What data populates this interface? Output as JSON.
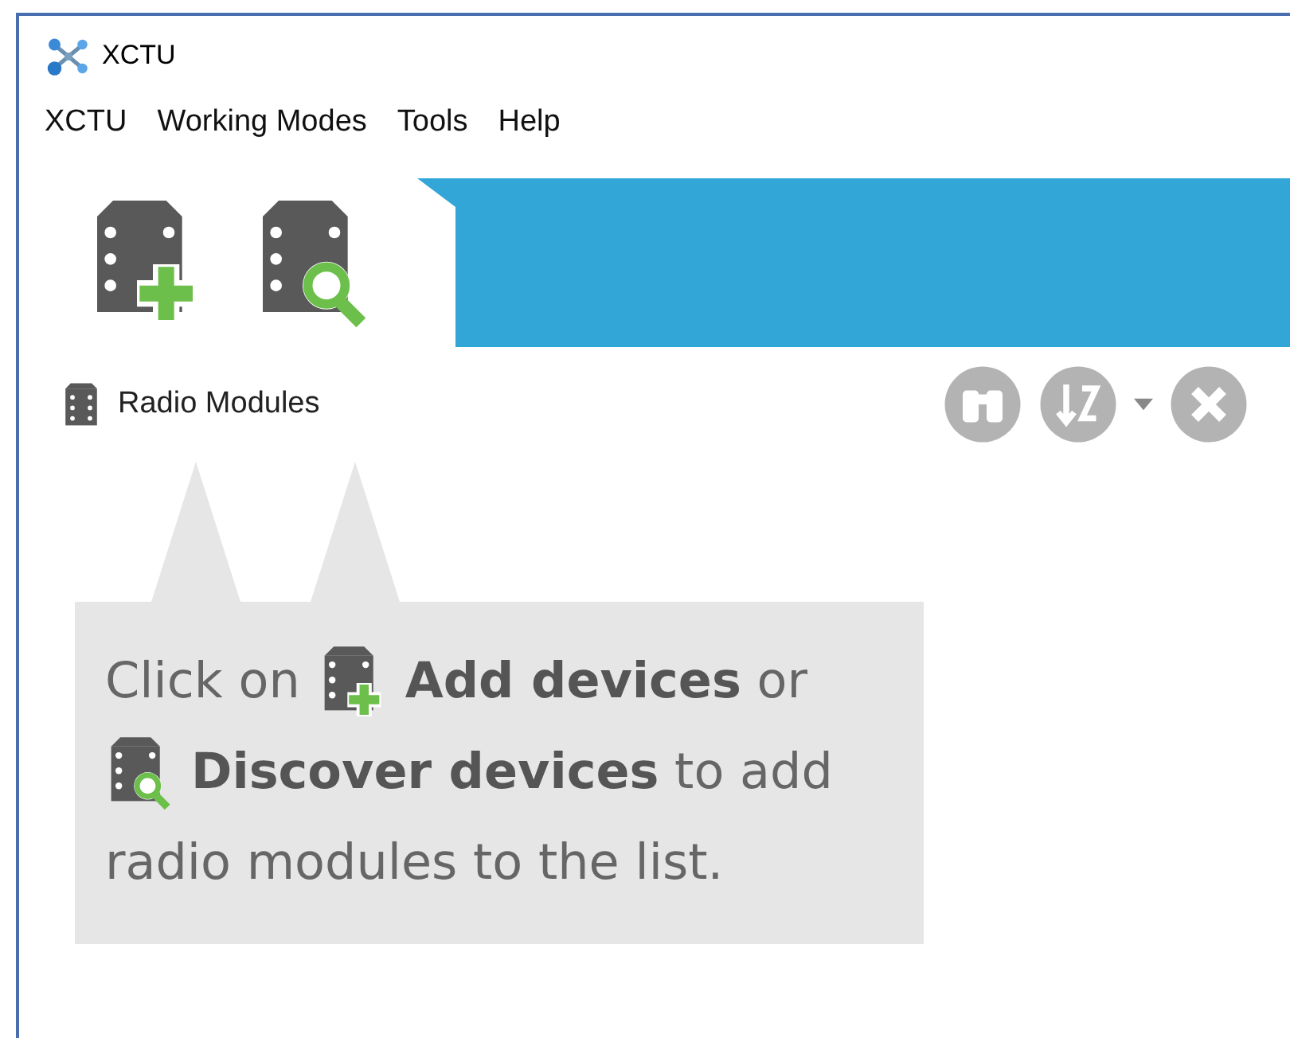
{
  "window": {
    "title": "XCTU"
  },
  "menu": [
    "XCTU",
    "Working Modes",
    "Tools",
    "Help"
  ],
  "panel": {
    "title": "Radio Modules"
  },
  "hint": {
    "lines": [
      {
        "kind": "add",
        "lead": "Click on",
        "text": "**Add devices** or"
      },
      {
        "kind": "discover",
        "text": "**Discover devices** to add"
      },
      {
        "kind": "plain",
        "text": "radio modules to the list."
      }
    ]
  }
}
